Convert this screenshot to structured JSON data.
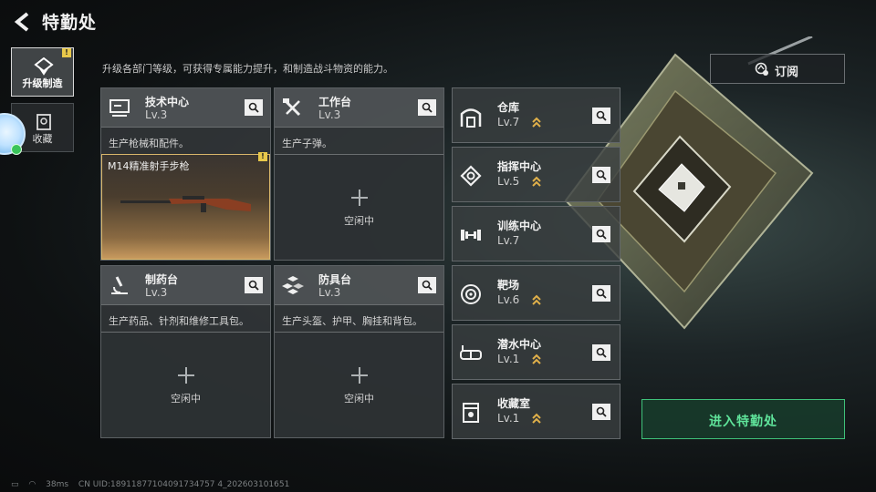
{
  "header": {
    "title": "特勤处"
  },
  "subtitle": "升级各部门等级，可获得专属能力提升，和制造战斗物资的能力。",
  "nav": [
    {
      "label": "升级制造",
      "active": true,
      "icon": "upgrade-icon",
      "warning": "!"
    },
    {
      "label": "收藏",
      "active": false,
      "icon": "collection-icon"
    }
  ],
  "cards": [
    {
      "name": "技术中心",
      "level": "Lv.3",
      "desc": "生产枪械和配件。",
      "icon": "computer-icon",
      "slot": {
        "item": "M14精准射手步枪",
        "warning": "!"
      }
    },
    {
      "name": "工作台",
      "level": "Lv.3",
      "desc": "生产子弹。",
      "icon": "tools-icon",
      "slot": {
        "label": "空闲中"
      }
    },
    {
      "name": "制药台",
      "level": "Lv.3",
      "desc": "生产药品、针剂和维修工具包。",
      "icon": "microscope-icon",
      "slot": {
        "label": "空闲中"
      }
    },
    {
      "name": "防具台",
      "level": "Lv.3",
      "desc": "生产头盔、护甲、胸挂和背包。",
      "icon": "armor-cubes-icon",
      "slot": {
        "label": "空闲中"
      }
    }
  ],
  "stations": [
    {
      "name": "仓库",
      "level": "Lv.7",
      "upgradable": true,
      "icon": "warehouse-icon"
    },
    {
      "name": "指挥中心",
      "level": "Lv.5",
      "upgradable": true,
      "icon": "command-chip-icon"
    },
    {
      "name": "训练中心",
      "level": "Lv.7",
      "upgradable": false,
      "icon": "dumbbell-icon"
    },
    {
      "name": "靶场",
      "level": "Lv.6",
      "upgradable": true,
      "icon": "target-icon"
    },
    {
      "name": "潜水中心",
      "level": "Lv.1",
      "upgradable": true,
      "icon": "dive-goggles-icon"
    },
    {
      "name": "收藏室",
      "level": "Lv.1",
      "upgradable": true,
      "icon": "collection-room-icon"
    }
  ],
  "subscribe": {
    "label": "订阅"
  },
  "enter": {
    "label": "进入特勤处"
  },
  "status": {
    "ping": "38ms",
    "uid": "CN UID:18911877104091734757 4_202603101651"
  },
  "colors": {
    "accent_green": "#5fe39a",
    "warning_yellow": "#e8c84a",
    "upgrade_gold": "#e0b04a"
  }
}
